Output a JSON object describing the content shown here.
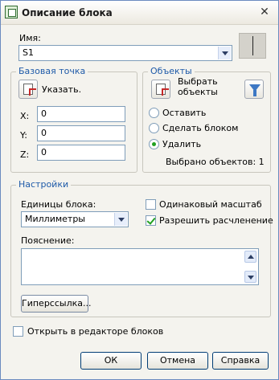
{
  "window": {
    "title": "Описание блока",
    "close": "✕"
  },
  "name_field": {
    "label": "Имя:",
    "value": "S1"
  },
  "base_point": {
    "title": "Базовая точка",
    "pick_label": "Указать.",
    "x_label": "X:",
    "x_value": "0",
    "y_label": "Y:",
    "y_value": "0",
    "z_label": "Z:",
    "z_value": "0"
  },
  "objects": {
    "title": "Объекты",
    "select_label_line1": "Выбрать",
    "select_label_line2": "объекты",
    "radio_keep": "Оставить",
    "radio_convert": "Сделать блоком",
    "radio_delete": "Удалить",
    "selected_status": "Выбрано объектов: 1"
  },
  "settings": {
    "title": "Настройки",
    "units_label": "Единицы блока:",
    "units_value": "Миллиметры",
    "uniform_scale": "Одинаковый масштаб",
    "allow_explode": "Разрешить расчленение",
    "description_label": "Пояснение:",
    "hyperlink_button": "Гиперссылка..."
  },
  "open_in_editor": "Открыть в редакторе блоков",
  "buttons": {
    "ok": "ОК",
    "cancel": "Отмена",
    "help": "Справка"
  },
  "icons": {
    "app": "autocad-block-icon",
    "close": "close-icon",
    "pick_point": "pick-point-icon",
    "select_objects": "select-objects-icon",
    "quick_select": "quick-select-filter-icon"
  },
  "colors": {
    "group_title": "#1e5aa8",
    "radio_check": "#21a121",
    "border": "#7f9db9"
  }
}
